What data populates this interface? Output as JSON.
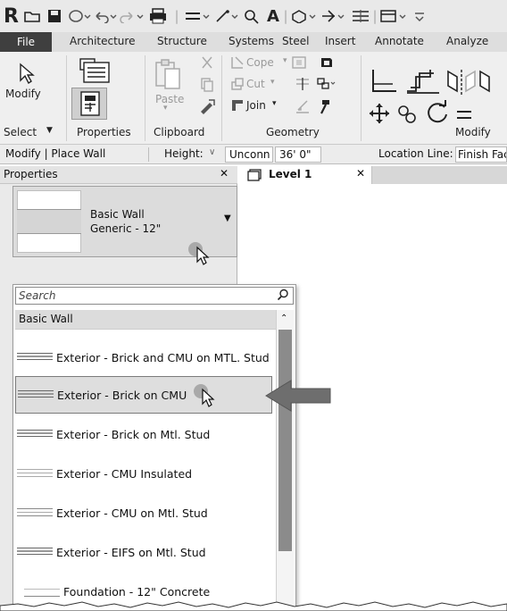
{
  "ribbon_tabs": [
    "File",
    "Architecture",
    "Structure",
    "Systems",
    "Steel",
    "Insert",
    "Annotate",
    "Analyze"
  ],
  "ribbon": {
    "modify_label": "Modify",
    "paste_label": "Paste",
    "cope_label": "Cope",
    "cut_label": "Cut",
    "join_label": "Join",
    "panels": {
      "select": "Select",
      "properties": "Properties",
      "clipboard": "Clipboard",
      "geometry": "Geometry",
      "modify": "Modify"
    }
  },
  "options_bar": {
    "context": "Modify | Place Wall",
    "height_label": "Height:",
    "unconn_value": "Unconn",
    "height_value": "36'  0\"",
    "location_line_label": "Location Line:",
    "location_line_value": "Finish Face"
  },
  "properties": {
    "title": "Properties",
    "close_glyph": "✕",
    "type_family": "Basic Wall",
    "type_name": "Generic - 12\""
  },
  "view": {
    "tab_label": "Level 1",
    "close_glyph": "✕"
  },
  "dropdown": {
    "search_placeholder": "Search",
    "group_label": "Basic Wall",
    "items": [
      "Exterior - Brick and CMU on MTL. Stud",
      "Exterior - Brick on CMU",
      "Exterior - Brick on Mtl. Stud",
      "Exterior - CMU Insulated",
      "Exterior - CMU on Mtl. Stud",
      "Exterior - EIFS on Mtl. Stud",
      "Foundation - 12\" Concrete"
    ],
    "selected_index": 1
  }
}
